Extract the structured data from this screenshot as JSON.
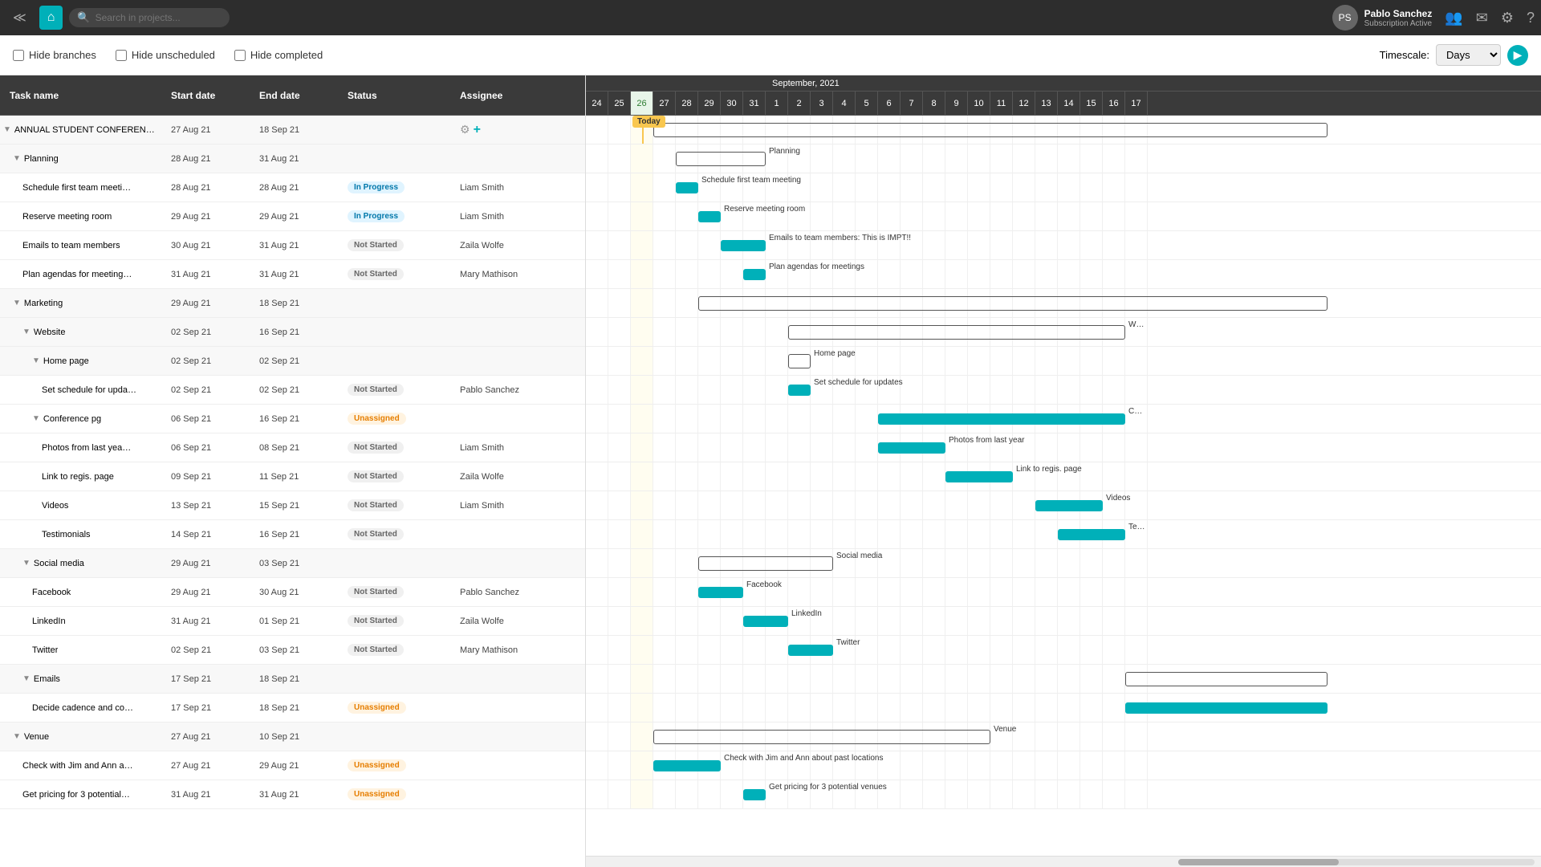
{
  "topbar": {
    "search_placeholder": "Search in projects...",
    "user_name": "Pablo Sanchez",
    "user_sub": "Subscription Active"
  },
  "toolbar": {
    "hide_branches": "Hide branches",
    "hide_unscheduled": "Hide unscheduled",
    "hide_completed": "Hide completed",
    "timescale_label": "Timescale:",
    "timescale_value": "Days"
  },
  "table": {
    "headers": [
      "Task name",
      "Start date",
      "End date",
      "Status",
      "Assignee"
    ],
    "rows": [
      {
        "id": "r1",
        "level": 0,
        "expand": true,
        "label": "ANNUAL STUDENT CONFEREN…",
        "start": "27 Aug 21",
        "end": "18 Sep 21",
        "status": "",
        "assignee": "",
        "isGroup": true,
        "actions": true
      },
      {
        "id": "r2",
        "level": 1,
        "expand": true,
        "label": "Planning",
        "start": "28 Aug 21",
        "end": "31 Aug 21",
        "status": "",
        "assignee": "",
        "isGroup": true
      },
      {
        "id": "r3",
        "level": 2,
        "expand": false,
        "label": "Schedule first team meeti…",
        "start": "28 Aug 21",
        "end": "28 Aug 21",
        "status": "In Progress",
        "assignee": "Liam Smith"
      },
      {
        "id": "r4",
        "level": 2,
        "expand": false,
        "label": "Reserve meeting room",
        "start": "29 Aug 21",
        "end": "29 Aug 21",
        "status": "In Progress",
        "assignee": "Liam Smith"
      },
      {
        "id": "r5",
        "level": 2,
        "expand": false,
        "label": "Emails to team members",
        "start": "30 Aug 21",
        "end": "31 Aug 21",
        "status": "Not Started",
        "assignee": "Zaila Wolfe"
      },
      {
        "id": "r6",
        "level": 2,
        "expand": false,
        "label": "Plan agendas for meeting…",
        "start": "31 Aug 21",
        "end": "31 Aug 21",
        "status": "Not Started",
        "assignee": "Mary Mathison"
      },
      {
        "id": "r7",
        "level": 1,
        "expand": true,
        "label": "Marketing",
        "start": "29 Aug 21",
        "end": "18 Sep 21",
        "status": "",
        "assignee": "",
        "isGroup": true
      },
      {
        "id": "r8",
        "level": 2,
        "expand": true,
        "label": "Website",
        "start": "02 Sep 21",
        "end": "16 Sep 21",
        "status": "",
        "assignee": "",
        "isGroup": true
      },
      {
        "id": "r9",
        "level": 3,
        "expand": true,
        "label": "Home page",
        "start": "02 Sep 21",
        "end": "02 Sep 21",
        "status": "",
        "assignee": "",
        "isGroup": true
      },
      {
        "id": "r10",
        "level": 4,
        "expand": false,
        "label": "Set schedule for upda…",
        "start": "02 Sep 21",
        "end": "02 Sep 21",
        "status": "Not Started",
        "assignee": "Pablo Sanchez"
      },
      {
        "id": "r11",
        "level": 3,
        "expand": true,
        "label": "Conference pg",
        "start": "06 Sep 21",
        "end": "16 Sep 21",
        "status": "Unassigned",
        "assignee": ""
      },
      {
        "id": "r12",
        "level": 4,
        "expand": false,
        "label": "Photos from last yea…",
        "start": "06 Sep 21",
        "end": "08 Sep 21",
        "status": "Not Started",
        "assignee": "Liam Smith"
      },
      {
        "id": "r13",
        "level": 4,
        "expand": false,
        "label": "Link to regis. page",
        "start": "09 Sep 21",
        "end": "11 Sep 21",
        "status": "Not Started",
        "assignee": "Zaila Wolfe"
      },
      {
        "id": "r14",
        "level": 4,
        "expand": false,
        "label": "Videos",
        "start": "13 Sep 21",
        "end": "15 Sep 21",
        "status": "Not Started",
        "assignee": "Liam Smith"
      },
      {
        "id": "r15",
        "level": 4,
        "expand": false,
        "label": "Testimonials",
        "start": "14 Sep 21",
        "end": "16 Sep 21",
        "status": "Not Started",
        "assignee": ""
      },
      {
        "id": "r16",
        "level": 2,
        "expand": true,
        "label": "Social media",
        "start": "29 Aug 21",
        "end": "03 Sep 21",
        "status": "",
        "assignee": "",
        "isGroup": true
      },
      {
        "id": "r17",
        "level": 3,
        "expand": false,
        "label": "Facebook",
        "start": "29 Aug 21",
        "end": "30 Aug 21",
        "status": "Not Started",
        "assignee": "Pablo Sanchez"
      },
      {
        "id": "r18",
        "level": 3,
        "expand": false,
        "label": "LinkedIn",
        "start": "31 Aug 21",
        "end": "01 Sep 21",
        "status": "Not Started",
        "assignee": "Zaila Wolfe"
      },
      {
        "id": "r19",
        "level": 3,
        "expand": false,
        "label": "Twitter",
        "start": "02 Sep 21",
        "end": "03 Sep 21",
        "status": "Not Started",
        "assignee": "Mary Mathison"
      },
      {
        "id": "r20",
        "level": 2,
        "expand": true,
        "label": "Emails",
        "start": "17 Sep 21",
        "end": "18 Sep 21",
        "status": "",
        "assignee": "",
        "isGroup": true
      },
      {
        "id": "r21",
        "level": 3,
        "expand": false,
        "label": "Decide cadence and co…",
        "start": "17 Sep 21",
        "end": "18 Sep 21",
        "status": "Unassigned",
        "assignee": ""
      },
      {
        "id": "r22",
        "level": 1,
        "expand": true,
        "label": "Venue",
        "start": "27 Aug 21",
        "end": "10 Sep 21",
        "status": "",
        "assignee": "",
        "isGroup": true
      },
      {
        "id": "r23",
        "level": 2,
        "expand": false,
        "label": "Check with Jim and Ann a…",
        "start": "27 Aug 21",
        "end": "29 Aug 21",
        "status": "Unassigned",
        "assignee": ""
      },
      {
        "id": "r24",
        "level": 2,
        "expand": false,
        "label": "Get pricing for 3 potential…",
        "start": "31 Aug 21",
        "end": "31 Aug 21",
        "status": "Unassigned",
        "assignee": ""
      }
    ]
  },
  "gantt": {
    "month_label": "September, 2021",
    "days_before": [
      "24",
      "25",
      "26",
      "27",
      "28",
      "29",
      "30",
      "31"
    ],
    "days_sep": [
      "1",
      "2",
      "3",
      "4",
      "5",
      "6",
      "7",
      "8",
      "9",
      "10",
      "11",
      "12",
      "13",
      "14",
      "15",
      "16",
      "17"
    ],
    "today_day": "26",
    "today_label": "Today"
  }
}
